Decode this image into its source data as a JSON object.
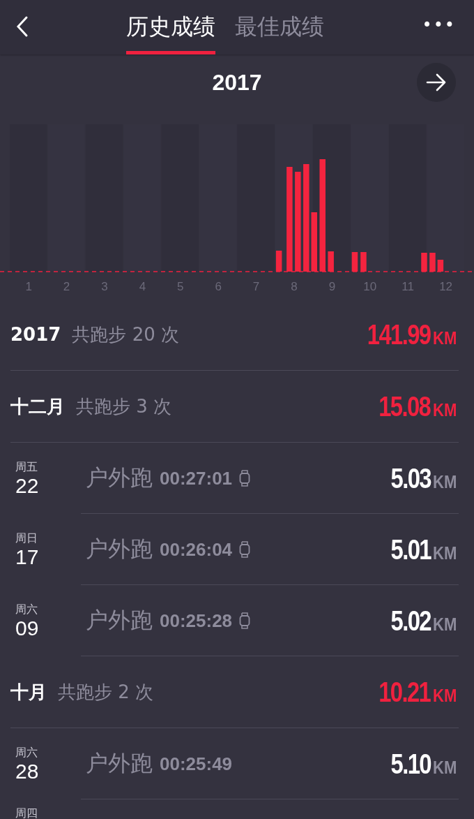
{
  "header": {
    "tabs": [
      {
        "label": "历史成绩",
        "selected": true
      },
      {
        "label": "最佳成绩",
        "selected": false
      }
    ],
    "more": "•••"
  },
  "year_bar": {
    "year": "2017"
  },
  "chart": {
    "month_labels": [
      "1",
      "2",
      "3",
      "4",
      "5",
      "6",
      "7",
      "8",
      "9",
      "10",
      "11",
      "12"
    ]
  },
  "summary": {
    "title": "2017",
    "label": "共跑步 20 次",
    "distance": "141.99",
    "unit": "KM"
  },
  "months": [
    {
      "name": "十二月",
      "label": "共跑步 3 次",
      "distance": "15.08",
      "unit": "KM",
      "runs": [
        {
          "weekday": "周五",
          "day": "22",
          "type": "户外跑",
          "duration": "00:27:01",
          "watch": true,
          "distance": "5.03",
          "unit": "KM"
        },
        {
          "weekday": "周日",
          "day": "17",
          "type": "户外跑",
          "duration": "00:26:04",
          "watch": true,
          "distance": "5.01",
          "unit": "KM"
        },
        {
          "weekday": "周六",
          "day": "09",
          "type": "户外跑",
          "duration": "00:25:28",
          "watch": true,
          "distance": "5.02",
          "unit": "KM"
        }
      ]
    },
    {
      "name": "十月",
      "label": "共跑步 2 次",
      "distance": "10.21",
      "unit": "KM",
      "runs": [
        {
          "weekday": "周六",
          "day": "28",
          "type": "户外跑",
          "duration": "00:25:49",
          "watch": false,
          "distance": "5.10",
          "unit": "KM"
        },
        {
          "weekday": "周四"
        }
      ]
    }
  ]
}
